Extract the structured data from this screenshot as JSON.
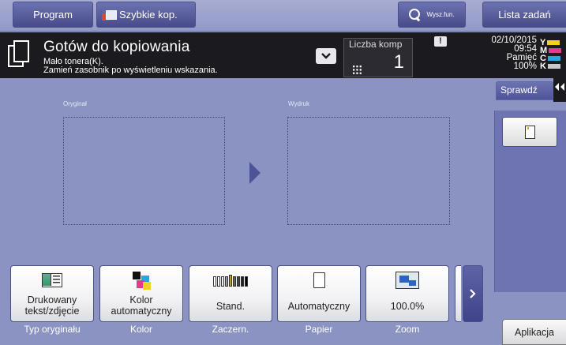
{
  "topbar": {
    "program": "Program",
    "quick_copy": "Szybkie kop.",
    "search": "Wysz.fun.",
    "job_list": "Lista zadań"
  },
  "status": {
    "title": "Gotów do kopiowania",
    "message_line1": "Mało tonera(K).",
    "message_line2": "Zamień zasobnik po wyświetleniu wskazania.",
    "copies_label": "Liczba komp",
    "copies_value": "1",
    "date": "02/10/2015",
    "time": "09:54",
    "memory_label": "Pamięć",
    "memory_value": "100%",
    "toner_labels": [
      "Y",
      "M",
      "C",
      "K"
    ],
    "toner_colors": [
      "#f2d21a",
      "#e23a8c",
      "#2aa6dd",
      "#c9c9c9"
    ]
  },
  "main": {
    "original_label": "Oryginał",
    "output_label": "Wydruk"
  },
  "side": {
    "check_tab": "Sprawdź"
  },
  "functions": [
    {
      "label_line1": "Drukowany",
      "label_line2": "tekst/zdjęcie",
      "caption": "Typ oryginału",
      "icon": "text-photo-icon"
    },
    {
      "label_line1": "Kolor",
      "label_line2": "automatyczny",
      "caption": "Kolor",
      "icon": "color-icon"
    },
    {
      "label_line1": "Stand.",
      "label_line2": "",
      "caption": "Zaczern.",
      "icon": "density-icon"
    },
    {
      "label_line1": "Automatyczny",
      "label_line2": "",
      "caption": "Papier",
      "icon": "paper-icon"
    },
    {
      "label_line1": "100.0%",
      "label_line2": "",
      "caption": "Zoom",
      "icon": "zoom-icon"
    }
  ],
  "bottom": {
    "applications": "Aplikacja"
  }
}
